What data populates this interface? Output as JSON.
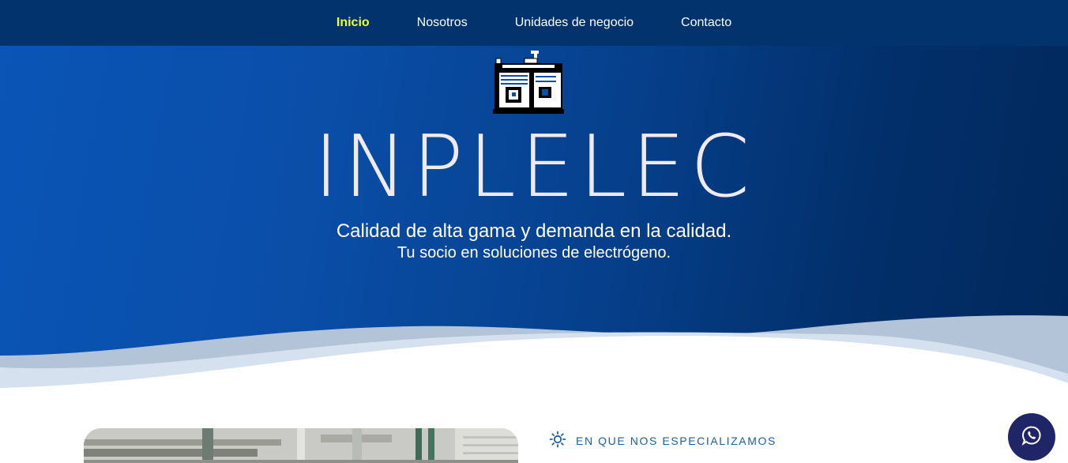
{
  "nav": {
    "items": [
      {
        "label": "Inicio",
        "active": true
      },
      {
        "label": "Nosotros",
        "active": false
      },
      {
        "label": "Unidades de negocio",
        "active": false
      },
      {
        "label": "Contacto",
        "active": false
      }
    ]
  },
  "hero": {
    "brand": "INPLELEC",
    "tagline": "Calidad de alta gama y demanda en la calidad.",
    "subtagline": "Tu socio en soluciones de electrógeno.",
    "logo_icon": "generator-logo-icon"
  },
  "section": {
    "label": "EN QUE NOS ESPECIALIZAMOS",
    "icon": "sun-icon"
  },
  "floating": {
    "whatsapp_icon": "whatsapp-icon"
  },
  "colors": {
    "nav_bg": "#02336d",
    "active_link": "#f2ff2e",
    "hero_start": "#0a55b7",
    "hero_end": "#01285c",
    "section_accent": "#1a5fa3",
    "whatsapp_bg": "#1f2566"
  }
}
